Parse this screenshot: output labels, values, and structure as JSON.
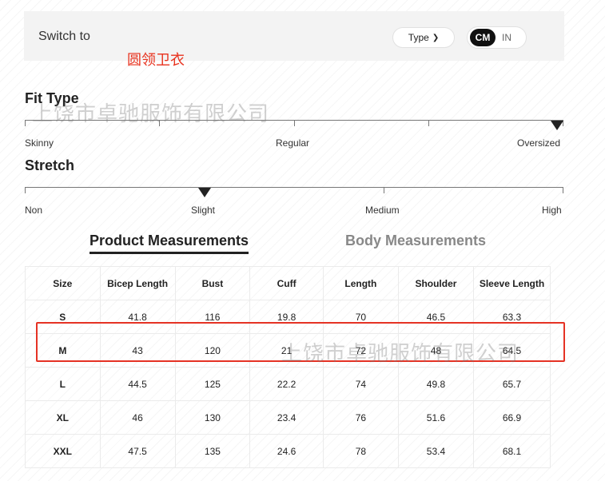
{
  "switch": {
    "label": "Switch to",
    "type_label": "Type",
    "unit_cm": "CM",
    "unit_in": "IN"
  },
  "note": "圆领卫衣",
  "fit_type": {
    "title": "Fit Type",
    "labels": [
      "Skinny",
      "Regular",
      "Oversized"
    ],
    "selected": "Oversized"
  },
  "stretch": {
    "title": "Stretch",
    "labels": [
      "Non",
      "Slight",
      "Medium",
      "High"
    ],
    "selected": "Slight"
  },
  "tabs": {
    "active": "Product Measurements",
    "inactive": "Body Measurements"
  },
  "table": {
    "headers": [
      "Size",
      "Bicep Length",
      "Bust",
      "Cuff",
      "Length",
      "Shoulder",
      "Sleeve Length"
    ],
    "rows": [
      [
        "S",
        "41.8",
        "116",
        "19.8",
        "70",
        "46.5",
        "63.3"
      ],
      [
        "M",
        "43",
        "120",
        "21",
        "72",
        "48",
        "64.5"
      ],
      [
        "L",
        "44.5",
        "125",
        "22.2",
        "74",
        "49.8",
        "65.7"
      ],
      [
        "XL",
        "46",
        "130",
        "23.4",
        "76",
        "51.6",
        "66.9"
      ],
      [
        "XXL",
        "47.5",
        "135",
        "24.6",
        "78",
        "53.4",
        "68.1"
      ]
    ],
    "highlighted_size": "M"
  },
  "watermark": "上饶市卓驰服饰有限公司",
  "colors": {
    "accent": "#111111",
    "highlight": "#e53224",
    "note": "#e8321e"
  }
}
